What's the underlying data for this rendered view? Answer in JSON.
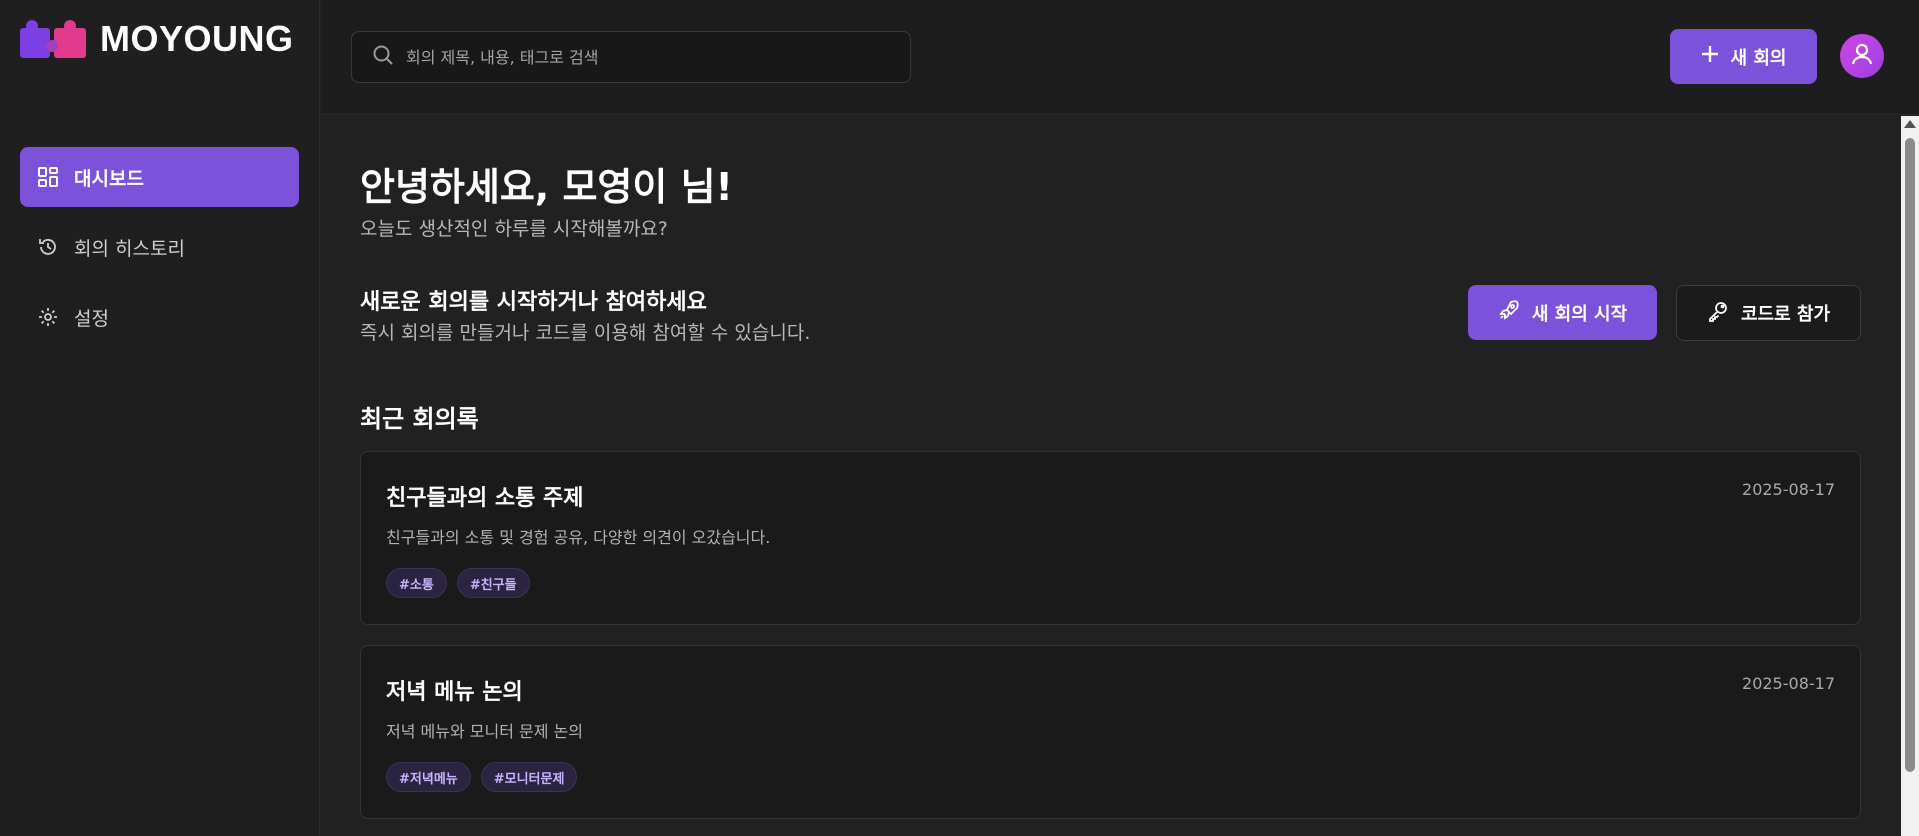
{
  "app": {
    "logo_text": "MOYOUNG"
  },
  "sidebar": {
    "items": [
      {
        "label": "대시보드",
        "icon": "dashboard-icon",
        "active": true
      },
      {
        "label": "회의 히스토리",
        "icon": "history-icon",
        "active": false
      },
      {
        "label": "설정",
        "icon": "gear-icon",
        "active": false
      }
    ]
  },
  "header": {
    "search_placeholder": "회의 제목, 내용, 태그로 검색",
    "new_button_label": "새 회의",
    "avatar_icon": "user-icon"
  },
  "main": {
    "greeting_title": "안녕하세요, 모영이 님!",
    "greeting_subtitle": "오늘도 생산적인 하루를 시작해볼까요?",
    "start_title": "새로운 회의를 시작하거나 참여하세요",
    "start_subtitle": "즉시 회의를 만들거나 코드를 이용해 참여할 수 있습니다.",
    "start_button_label": "새 회의 시작",
    "code_button_label": "코드로 참가",
    "recent_title": "최근 회의록",
    "meetings": [
      {
        "title": "친구들과의 소통 주제",
        "date": "2025-08-17",
        "description": "친구들과의 소통 및 경험 공유, 다양한 의견이 오갔습니다.",
        "tags": [
          "#소통",
          "#친구들"
        ]
      },
      {
        "title": "저녁 메뉴 논의",
        "date": "2025-08-17",
        "description": "저녁 메뉴와 모니터 문제 논의",
        "tags": [
          "#저녁메뉴",
          "#모니터문제"
        ]
      }
    ]
  },
  "colors": {
    "accent": "#7c52da",
    "background": "#212121",
    "sidebar": "#1f1f1f",
    "card": "#1a1a1a",
    "tag_text": "#c8b3ff"
  }
}
